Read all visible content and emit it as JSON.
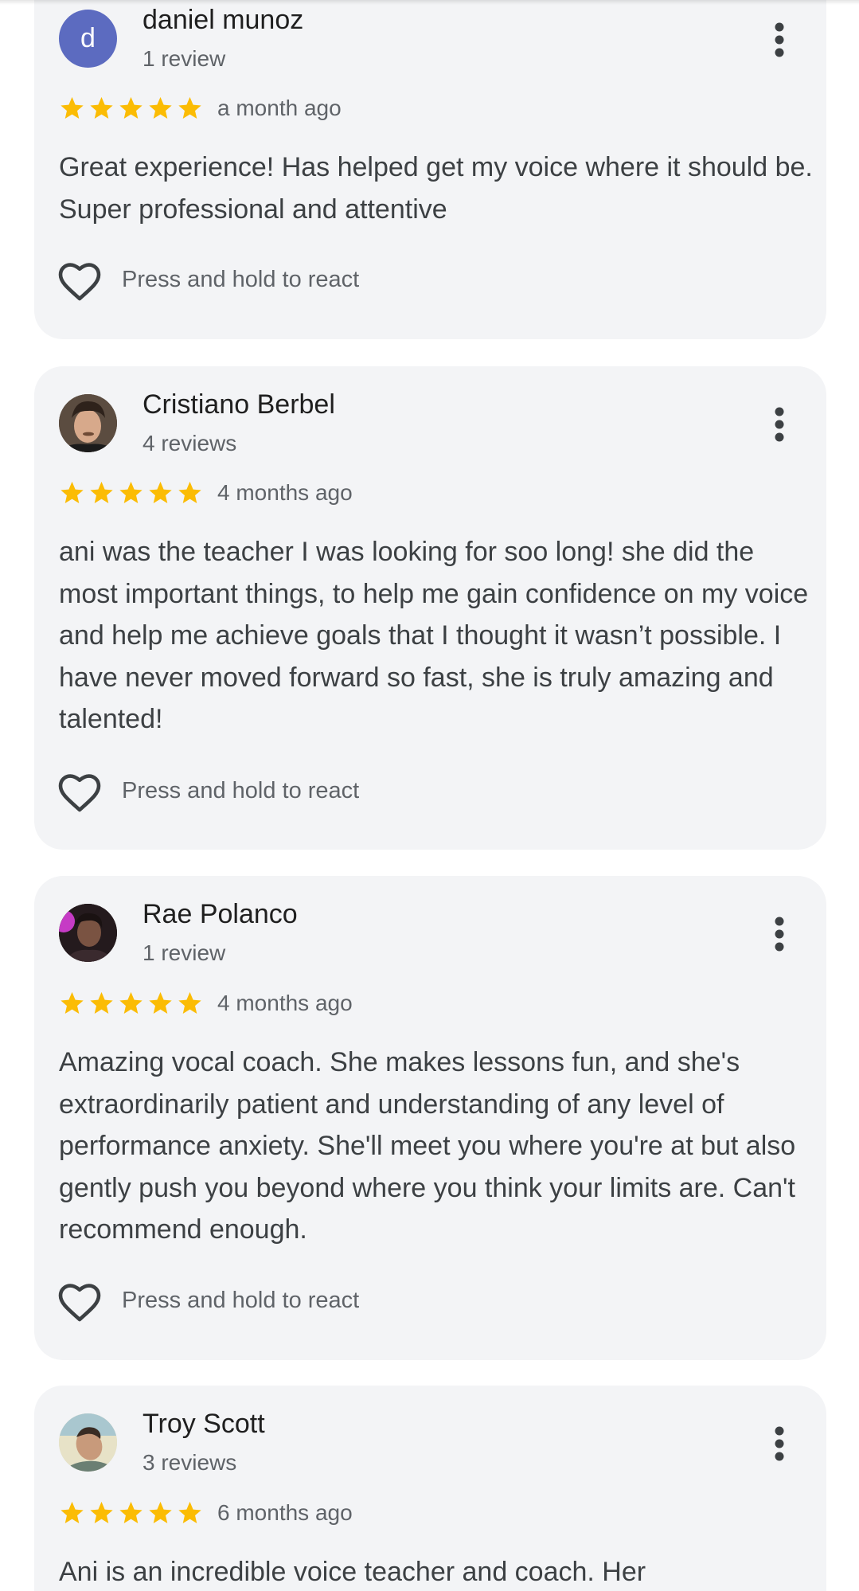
{
  "colors": {
    "card_bg": "#f3f4f6",
    "star": "#fbbc04",
    "avatar_letter_bg": "#5c6bc0",
    "name_text": "#1f1f1f",
    "secondary_text": "#5f6368",
    "body_text": "#3c4043"
  },
  "icons": {
    "star": "star-icon",
    "more": "more-vertical-icon",
    "react": "heart-outline-icon"
  },
  "reviews": [
    {
      "avatar_letter": "d",
      "name": "daniel munoz",
      "review_count": "1 review",
      "rating": 5,
      "time": "a month ago",
      "text": "Great experience! Has helped get my voice where it should be. Super professional and attentive",
      "react_label": "Press and hold to react"
    },
    {
      "avatar_letter": "",
      "name": "Cristiano Berbel",
      "review_count": "4 reviews",
      "rating": 5,
      "time": "4 months ago",
      "text": "ani was the teacher I was looking for soo long! she did the most important things, to help me gain confidence on my voice and help me achieve goals that I thought it wasn’t possible. I have never moved forward so fast, she is truly amazing and talented!",
      "react_label": "Press and hold to react"
    },
    {
      "avatar_letter": "",
      "name": "Rae Polanco",
      "review_count": "1 review",
      "rating": 5,
      "time": "4 months ago",
      "text": "Amazing vocal coach. She makes lessons fun, and she's extraordinarily patient and understanding of any level of performance anxiety. She'll meet you where you're at but also gently push you beyond where you think your limits are. Can't recommend enough.",
      "react_label": "Press and hold to react"
    },
    {
      "avatar_letter": "",
      "name": "Troy Scott",
      "review_count": "3 reviews",
      "rating": 5,
      "time": "6 months ago",
      "text": "Ani is an incredible voice teacher and coach. Her",
      "react_label": ""
    }
  ]
}
